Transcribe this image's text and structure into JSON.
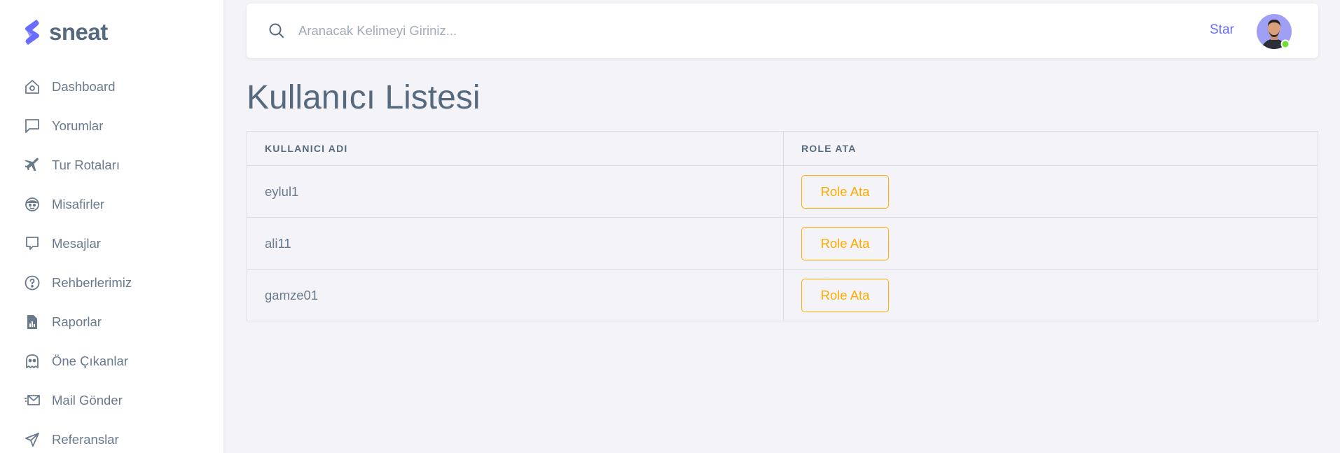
{
  "brand": {
    "name": "sneat",
    "accent": "#696cff"
  },
  "sidebar": {
    "items": [
      {
        "label": "Dashboard",
        "icon": "home-icon"
      },
      {
        "label": "Yorumlar",
        "icon": "comment-icon"
      },
      {
        "label": "Tur Rotaları",
        "icon": "plane-icon"
      },
      {
        "label": "Misafirler",
        "icon": "face-icon"
      },
      {
        "label": "Mesajlar",
        "icon": "message-icon"
      },
      {
        "label": "Rehberlerimiz",
        "icon": "help-circle-icon"
      },
      {
        "label": "Raporlar",
        "icon": "report-file-icon"
      },
      {
        "label": "Öne Çıkanlar",
        "icon": "ghost-icon"
      },
      {
        "label": "Mail Gönder",
        "icon": "mail-send-icon"
      },
      {
        "label": "Referanslar",
        "icon": "send-icon"
      }
    ]
  },
  "topbar": {
    "search_placeholder": "Aranacak Kelimeyi Giriniz...",
    "star_label": "Star"
  },
  "main": {
    "title": "Kullanıcı Listesi",
    "table": {
      "headers": [
        "KULLANICI ADI",
        "ROLE ATA"
      ],
      "rows": [
        {
          "username": "eylul1",
          "action": "Role Ata"
        },
        {
          "username": "ali11",
          "action": "Role Ata"
        },
        {
          "username": "gamze01",
          "action": "Role Ata"
        }
      ]
    }
  },
  "colors": {
    "warning": "#ffab00",
    "online": "#71dd37"
  }
}
